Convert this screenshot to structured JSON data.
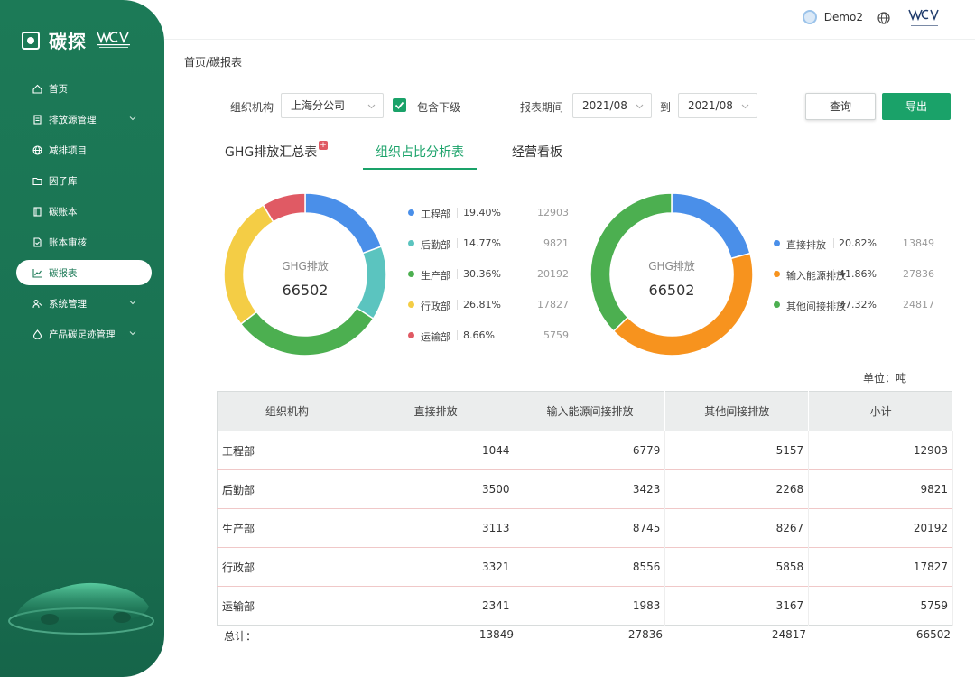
{
  "brand": {
    "name": "碳探"
  },
  "header": {
    "user": "Demo2"
  },
  "sidebar": {
    "items": [
      {
        "label": "首页",
        "icon": "home-icon",
        "has_children": false
      },
      {
        "label": "排放源管理",
        "icon": "document-icon",
        "has_children": true
      },
      {
        "label": "减排项目",
        "icon": "globe-icon",
        "has_children": false
      },
      {
        "label": "因子库",
        "icon": "folder-icon",
        "has_children": false
      },
      {
        "label": "碳账本",
        "icon": "book-icon",
        "has_children": false
      },
      {
        "label": "账本审核",
        "icon": "file-check-icon",
        "has_children": false
      },
      {
        "label": "碳报表",
        "icon": "line-chart-icon",
        "has_children": false,
        "active": true
      },
      {
        "label": "系统管理",
        "icon": "users-icon",
        "has_children": true
      },
      {
        "label": "产品碳足迹管理",
        "icon": "drop-icon",
        "has_children": true
      }
    ]
  },
  "breadcrumb": "首页/碳报表",
  "filters": {
    "org_label": "组织机构",
    "org_value": "上海分公司",
    "include_sub_label": "包含下级",
    "include_sub_checked": true,
    "period_label": "报表期间",
    "period_from": "2021/08",
    "to_label": "到",
    "period_to": "2021/08",
    "query_label": "查询",
    "export_label": "导出"
  },
  "tabs": [
    {
      "label": "GHG排放汇总表",
      "active": false,
      "badge": "+"
    },
    {
      "label": "组织占比分析表",
      "active": true
    },
    {
      "label": "经营看板",
      "active": false
    }
  ],
  "chart_data": [
    {
      "type": "pie",
      "center_label": "GHG排放",
      "center_value": "66502",
      "slices": [
        {
          "name": "工程部",
          "percent": "19.40%",
          "value": 12903,
          "color": "#4a8fe9"
        },
        {
          "name": "后勤部",
          "percent": "14.77%",
          "value": 9821,
          "color": "#5bc4bf"
        },
        {
          "name": "生产部",
          "percent": "30.36%",
          "value": 20192,
          "color": "#4caf50"
        },
        {
          "name": "行政部",
          "percent": "26.81%",
          "value": 17827,
          "color": "#f4cd45"
        },
        {
          "name": "运输部",
          "percent": "8.66%",
          "value": 5759,
          "color": "#e05a64"
        }
      ]
    },
    {
      "type": "pie",
      "center_label": "GHG排放",
      "center_value": "66502",
      "slices": [
        {
          "name": "直接排放",
          "percent": "20.82%",
          "value": 13849,
          "color": "#4a8fe9"
        },
        {
          "name": "输入能源排放",
          "percent": "41.86%",
          "value": 27836,
          "color": "#f7931e"
        },
        {
          "name": "其他间接排放",
          "percent": "37.32%",
          "value": 24817,
          "color": "#4caf50"
        }
      ]
    }
  ],
  "unit_label": "单位：吨",
  "table": {
    "headers": [
      "组织机构",
      "直接排放",
      "输入能源间接排放",
      "其他间接排放",
      "小计"
    ],
    "rows": [
      [
        "工程部",
        "1044",
        "6779",
        "5157",
        "12903"
      ],
      [
        "后勤部",
        "3500",
        "3423",
        "2268",
        "9821"
      ],
      [
        "生产部",
        "3113",
        "8745",
        "8267",
        "20192"
      ],
      [
        "行政部",
        "3321",
        "8556",
        "5858",
        "17827"
      ],
      [
        "运输部",
        "2341",
        "1983",
        "3167",
        "5759"
      ]
    ],
    "totals": [
      "总计：",
      "13849",
      "27836",
      "24817",
      "66502"
    ]
  },
  "colors": {
    "accent": "#1aa269",
    "sidebar": "#1c7a57"
  }
}
